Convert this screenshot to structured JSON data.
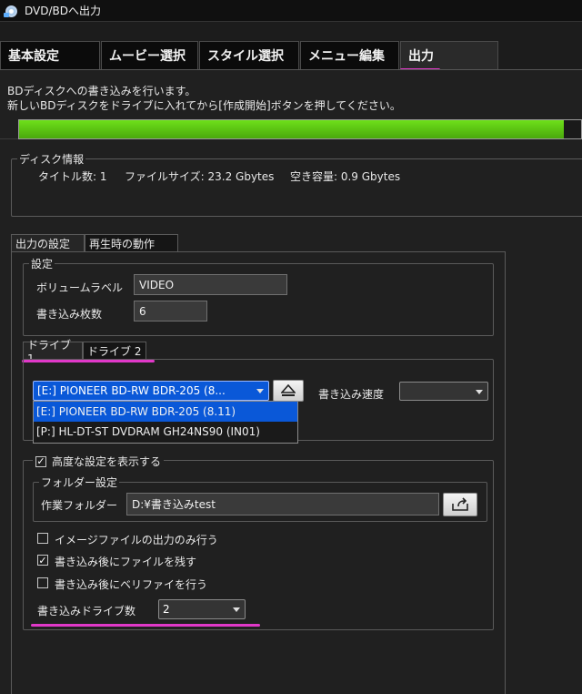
{
  "window": {
    "title": "DVD/BDへ出力"
  },
  "tabs": [
    {
      "label": "基本設定"
    },
    {
      "label": "ムービー選択"
    },
    {
      "label": "スタイル選択"
    },
    {
      "label": "メニュー編集"
    },
    {
      "label": "出力"
    }
  ],
  "description": {
    "line1": "BDディスクへの書き込みを行います。",
    "line2": "新しいBDディスクをドライブに入れてから[作成開始]ボタンを押してください。"
  },
  "disc_info": {
    "group_label": "ディスク情報",
    "titles_label": "タイトル数: 1",
    "file_size_label": "ファイルサイズ: 23.2 Gbytes",
    "free_space_label": "空き容量: 0.9 Gbytes",
    "usage_fraction": 0.97
  },
  "sub_tabs": [
    {
      "label": "出力の設定"
    },
    {
      "label": "再生時の動作"
    }
  ],
  "settings": {
    "group_label": "設定",
    "volume_label_caption": "ボリュームラベル",
    "volume_label_value": "VIDEO",
    "copies_caption": "書き込み枚数",
    "copies_value": "6"
  },
  "drive_tabs": [
    {
      "label": "ドライブ 1"
    },
    {
      "label": "ドライブ 2"
    }
  ],
  "drive": {
    "selected": "[E:] PIONEER BD-RW   BDR-205 (8...",
    "eject_icon": "eject-icon",
    "write_speed_caption": "書き込み速度",
    "write_speed_value": "",
    "options": [
      "[E:] PIONEER BD-RW   BDR-205 (8.11)",
      "[P:] HL-DT-ST DVDRAM GH24NS90 (IN01)"
    ]
  },
  "advanced": {
    "group_label": "高度な設定を表示する",
    "checked": true,
    "folder_group_label": "フォルダー設定",
    "work_folder_caption": "作業フォルダー",
    "work_folder_value": "D:¥書き込みtest",
    "browse_icon": "folder-upload-icon",
    "options": [
      {
        "label": "イメージファイルの出力のみ行う",
        "checked": false
      },
      {
        "label": "書き込み後にファイルを残す",
        "checked": true
      },
      {
        "label": "書き込み後にベリファイを行う",
        "checked": false
      }
    ],
    "drive_count_caption": "書き込みドライブ数",
    "drive_count_value": "2"
  },
  "colors": {
    "progress": "#5cc414",
    "selection": "#0a58d8",
    "annotation": "#e038c8"
  }
}
